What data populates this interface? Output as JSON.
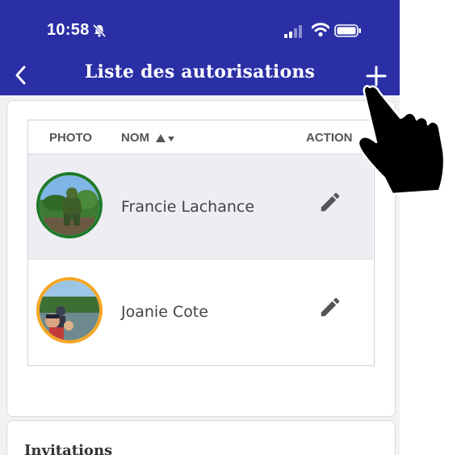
{
  "status_bar": {
    "time": "10:58",
    "icons": [
      "bell-slash-icon",
      "signal-icon",
      "wifi-icon",
      "battery-icon"
    ]
  },
  "nav": {
    "title": "Liste des autorisations",
    "back_icon": "chevron-left-icon",
    "add_icon": "plus-icon"
  },
  "table": {
    "headers": {
      "photo": "PHOTO",
      "nom": "NOM",
      "action": "ACTION"
    },
    "rows": [
      {
        "name": "Francie Lachance",
        "avatar_ring": "#1f7a2a",
        "action_icon": "pencil-icon"
      },
      {
        "name": "Joanie Cote",
        "avatar_ring": "#f5a623",
        "action_icon": "pencil-icon"
      }
    ]
  },
  "invitations": {
    "title": "Invitations"
  },
  "colors": {
    "header_bg": "#2b2fa6",
    "selected_row": "#ededf3"
  },
  "overlay": {
    "icon": "pointing-hand-icon"
  }
}
